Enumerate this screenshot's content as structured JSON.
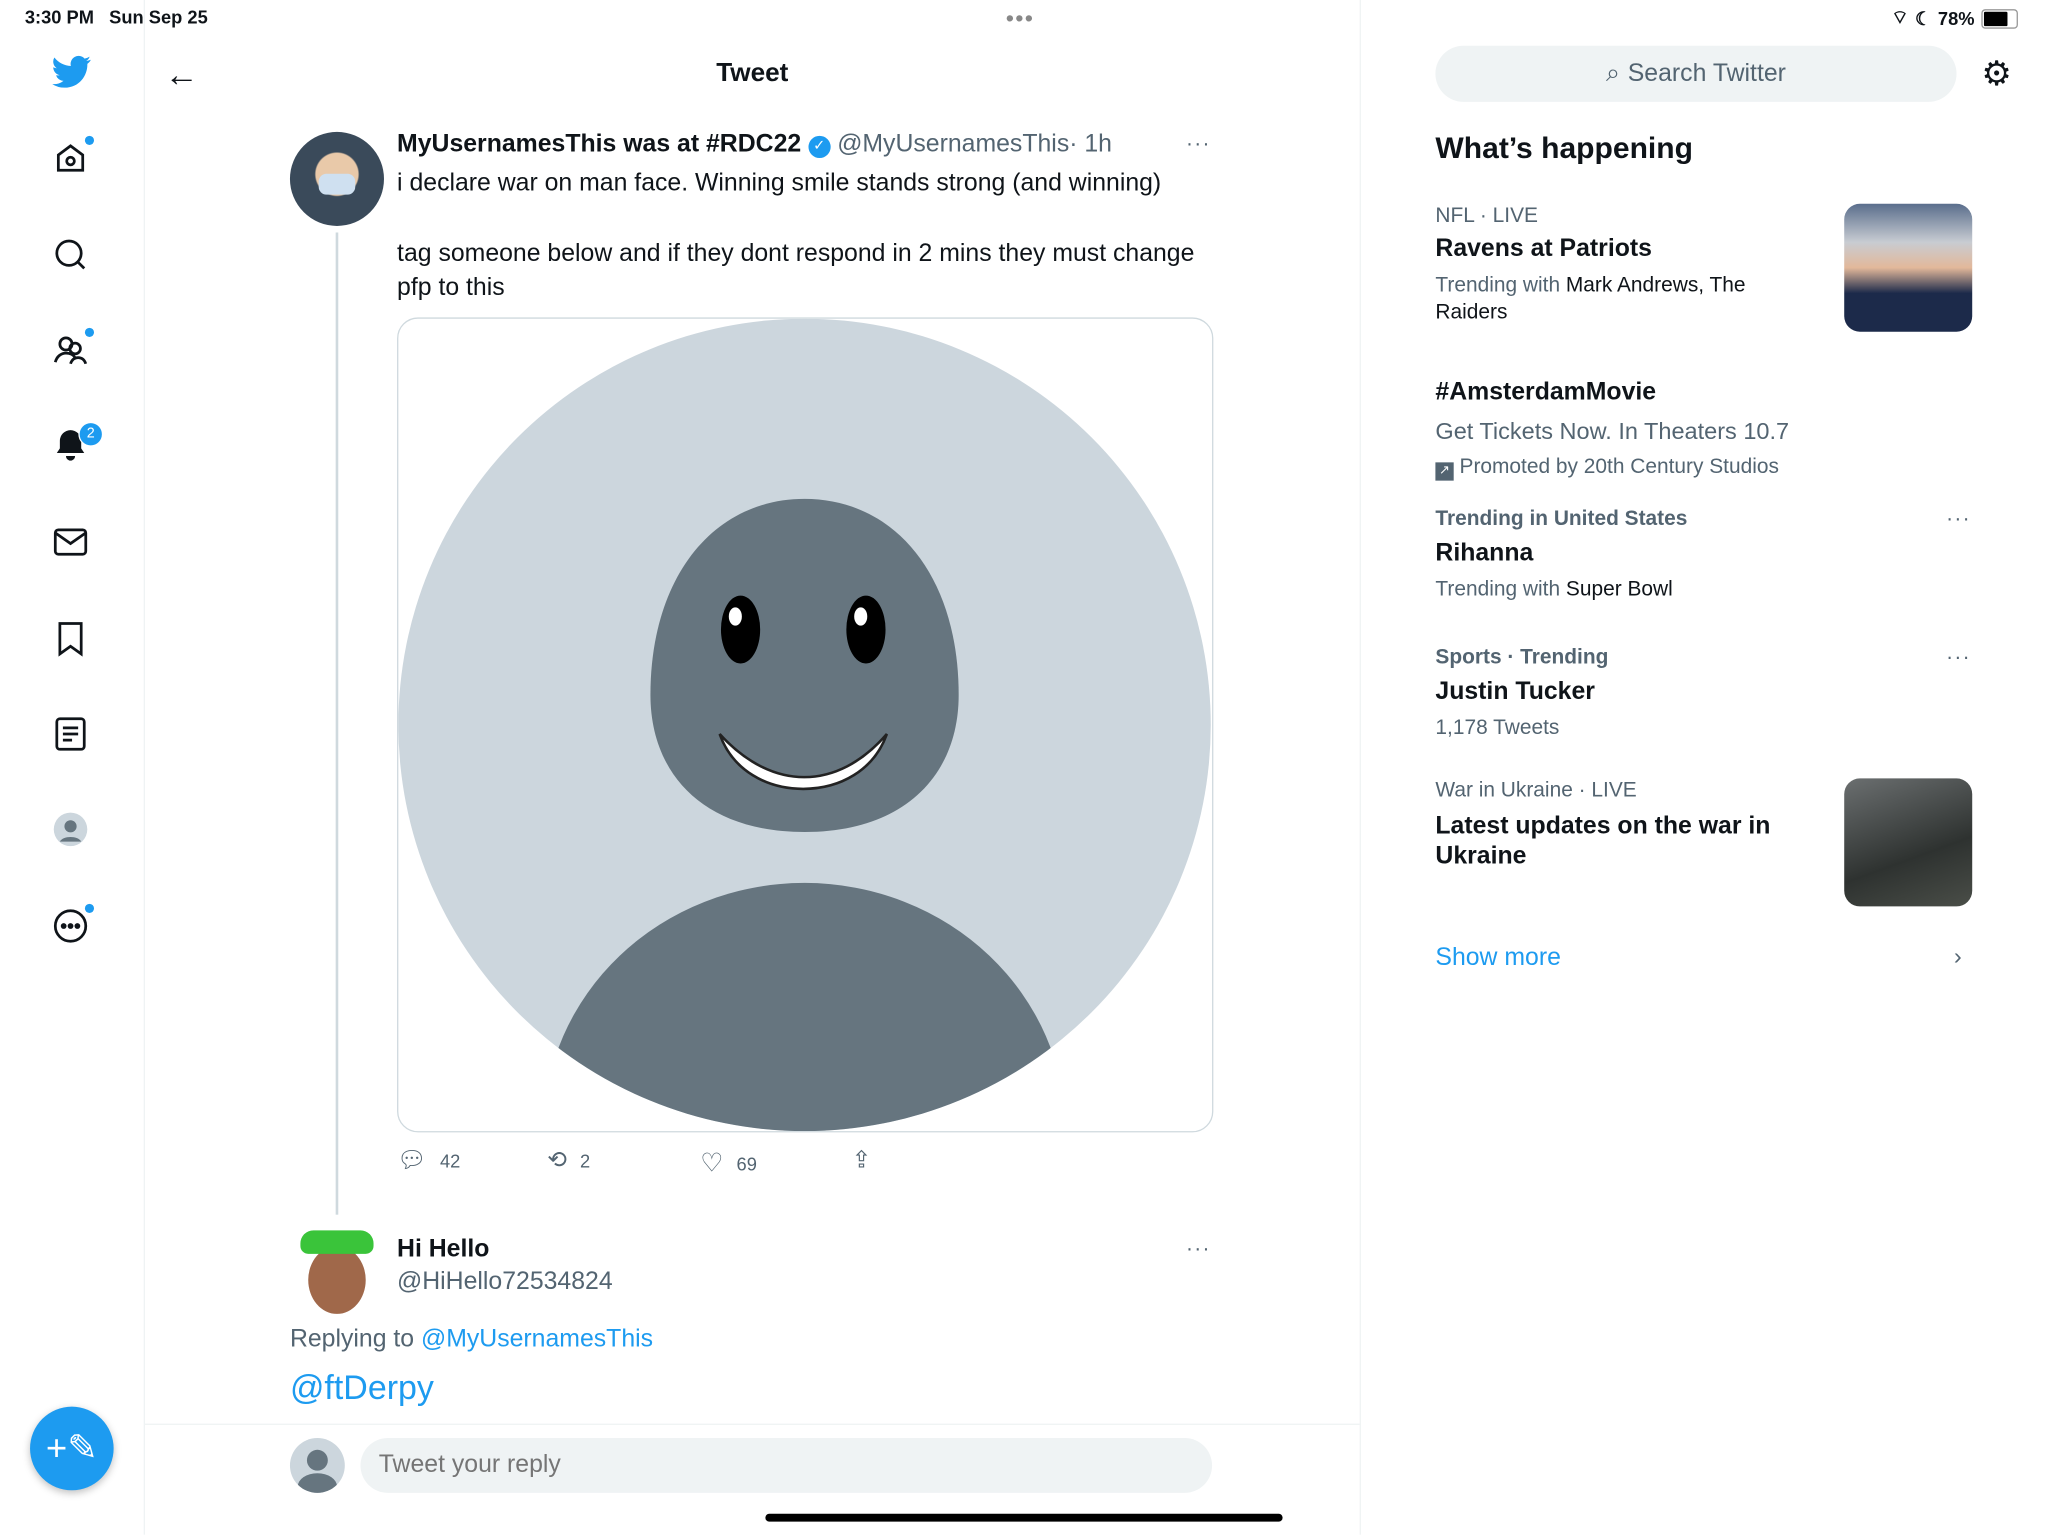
{
  "status_bar": {
    "time": "3:30 PM",
    "date": "Sun Sep 25",
    "battery": "78%"
  },
  "sidebar": {
    "items": [
      {
        "icon": "twitter-logo-icon"
      },
      {
        "icon": "home-icon"
      },
      {
        "icon": "search-icon"
      },
      {
        "icon": "communities-icon"
      },
      {
        "icon": "notifications-icon",
        "badge": "2"
      },
      {
        "icon": "messages-icon"
      },
      {
        "icon": "bookmarks-icon"
      },
      {
        "icon": "lists-icon"
      },
      {
        "icon": "profile-icon"
      },
      {
        "icon": "more-icon"
      }
    ],
    "compose": "compose-tweet-icon"
  },
  "header": {
    "title": "Tweet"
  },
  "tweet": {
    "name": "MyUsernamesThis was at #RDC22",
    "handle": "@MyUsernamesThis",
    "time": "· 1h",
    "text1": "i declare war on man face. Winning smile stands strong (and winning)",
    "text2": "tag someone below and if they dont respond in 2 mins they must change pfp to this",
    "replies": "42",
    "retweets": "2",
    "likes": "69"
  },
  "reply": {
    "name": "Hi Hello",
    "handle": "@HiHello72534824",
    "replying_to_label": "Replying to",
    "replying_to": "@MyUsernamesThis",
    "text": "@ftDerpy"
  },
  "composer": {
    "placeholder": "Tweet your reply"
  },
  "right": {
    "search_placeholder": "Search Twitter",
    "heading": "What’s happening",
    "trends": [
      {
        "meta": "NFL · LIVE",
        "title": "Ravens at Patriots",
        "sub_prefix": "Trending with",
        "sub": "Mark Andrews, The Raiders"
      },
      {
        "title": "#AmsterdamMovie",
        "sub": "Get Tickets Now. In Theaters 10.7",
        "promoted": "Promoted by 20th Century Studios"
      },
      {
        "meta": "Trending in United States",
        "title": "Rihanna",
        "sub_prefix": "Trending with",
        "sub": "Super Bowl"
      },
      {
        "meta": "Sports · Trending",
        "title": "Justin Tucker",
        "sub": "1,178 Tweets"
      },
      {
        "meta": "War in Ukraine · LIVE",
        "title": "Latest updates on the war in Ukraine"
      }
    ],
    "show_more": "Show more"
  },
  "colors": {
    "accent": "#1d9bf0",
    "text": "#0f1419",
    "muted": "#536471"
  }
}
